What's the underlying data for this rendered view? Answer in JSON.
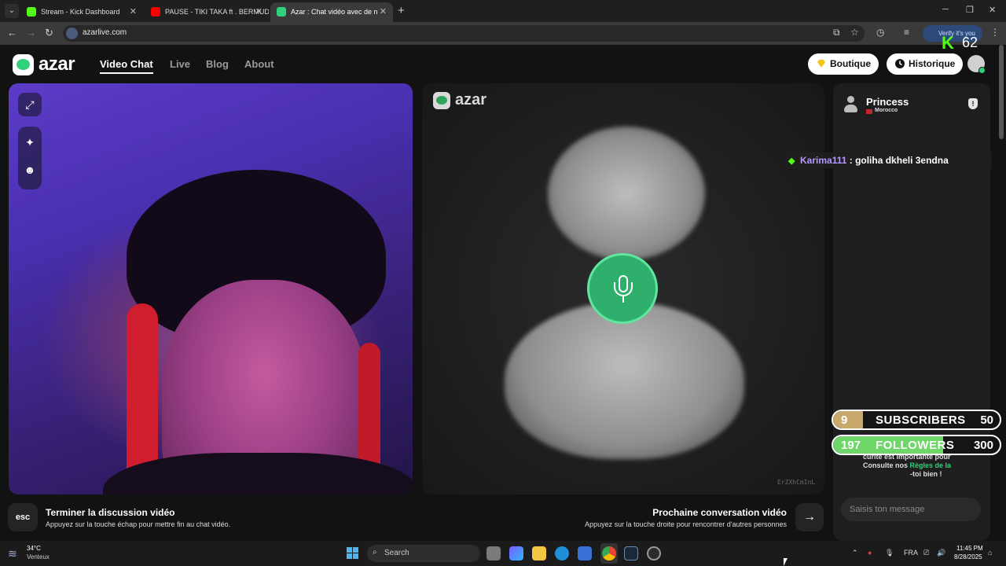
{
  "browser": {
    "tabs": [
      {
        "title": "Stream - Kick Dashboard",
        "favicon_color": "#53fc18"
      },
      {
        "title": "PAUSE - TIKI TAKA ft . BERMUDA",
        "favicon_color": "#ff0000"
      },
      {
        "title": "Azar : Chat vidéo avec de n",
        "favicon_color": "#2fd27a"
      }
    ],
    "url": "azarlive.com",
    "verify_label": "Verify it's you"
  },
  "overlay": {
    "kick_viewer_count": "62",
    "chat": {
      "user": "Karima111",
      "separator": " : ",
      "message": "goliha dkheli 3endna"
    },
    "subscribers": {
      "current": "9",
      "label": "SUBSCRIBERS",
      "goal": "50",
      "progress": 0.18
    },
    "followers": {
      "current": "197",
      "label": "FOLLOWERS",
      "goal": "300",
      "progress": 0.66
    }
  },
  "site": {
    "logo_text": "azar",
    "nav": [
      "Video Chat",
      "Live",
      "Blog",
      "About"
    ],
    "boutique_label": "Boutique",
    "historique_label": "Historique",
    "center_logo_text": "azar",
    "watermark": "ErZXhCmInL",
    "partner": {
      "name": "Princess",
      "country": "Morocco"
    },
    "safety_line1": "curité est importante pour",
    "safety_line2_pre": "Consulte nos ",
    "safety_line2_link": "Règles de la",
    "safety_line3": "-toi bien !",
    "message_placeholder": "Saisis ton message",
    "esc_key": "esc",
    "end_title": "Terminer la discussion vidéo",
    "end_sub": "Appuyez sur la touche échap pour mettre fin au chat vidéo.",
    "next_title": "Prochaine conversation vidéo",
    "next_sub": "Appuyez sur la touche droite pour rencontrer d'autres personnes"
  },
  "taskbar": {
    "temp": "34°C",
    "weather": "Venteux",
    "search_label": "Search",
    "lang": "FRA",
    "time": "11:45 PM",
    "date": "8/28/2025"
  }
}
